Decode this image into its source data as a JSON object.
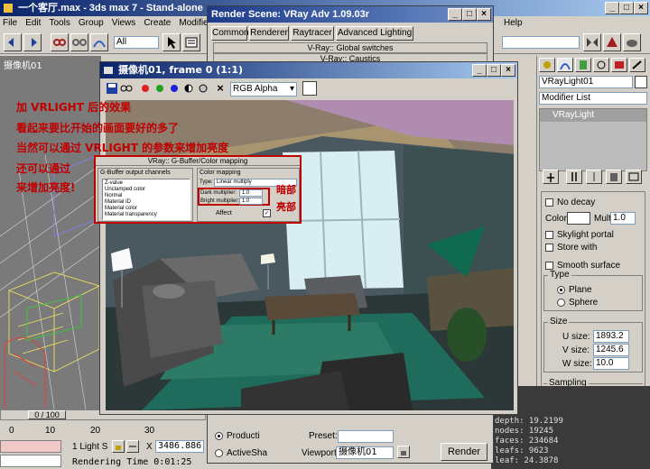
{
  "main_window": {
    "title": "一个客厅.max - 3ds max 7 - Stand-alone",
    "menu": [
      "File",
      "Edit",
      "Tools",
      "Group",
      "Views",
      "Create",
      "Modifiers",
      "Help"
    ],
    "selection_filter": "All",
    "viewport_label": "摄像机01"
  },
  "render_scene": {
    "title": "Render Scene: VRay Adv 1.09.03r",
    "tabs": [
      "Common",
      "Renderer",
      "Raytracer",
      "Advanced Lighting"
    ],
    "rollout_1": "V-Ray:: Global switches",
    "rollout_2": "V-Ray:: Caustics",
    "radio_production": "Producti",
    "radio_activeshade": "ActiveSha",
    "preset_label": "Preset:",
    "viewport_label": "Viewport:",
    "viewport_value": "摄像机01",
    "render_button": "Render"
  },
  "frame_window": {
    "title": "摄像机01, frame 0 (1:1)",
    "channel": "RGB Alpha"
  },
  "gbuffer_panel": {
    "title": "VRay:: G-Buffer/Color mapping",
    "channels_label": "G-Buffer output channels",
    "channels": [
      "Z-value",
      "Unclamped color",
      "Normal",
      "Material ID",
      "Material color",
      "Material transparency"
    ],
    "color_mapping_label": "Color mapping",
    "type_label": "Type:",
    "type_value": "Linear multiply",
    "dark_label": "Dark multiplier:",
    "dark_value": "1.0",
    "bright_label": "Bright multiplier:",
    "bright_value": "1.0",
    "affect_label": "Affect"
  },
  "annotations": {
    "line1": "加 VRLIGHT 后的效果",
    "line2": "看起来要比开始的画面要好的多了",
    "line3": "当然可以通过 VRLIGHT 的参数来增加亮度",
    "line4": "还可以通过",
    "line5": "来增加亮度!",
    "dark_note": "暗部",
    "bright_note": "亮部"
  },
  "command_panel": {
    "object_name": "VRayLight01",
    "modifier_list": "Modifier List",
    "stack_item": "VRayLight",
    "no_decay": "No decay",
    "color_label": "Color:",
    "mult_label": "Mult:",
    "mult_value": "1.0",
    "skylight": "Skylight portal",
    "store_with": "Store with",
    "smooth_surface": "Smooth surface",
    "type_group": "Type",
    "plane": "Plane",
    "sphere": "Sphere",
    "size_group": "Size",
    "u_label": "U size:",
    "u_value": "1893.2",
    "v_label": "V size:",
    "v_value": "1245.6",
    "w_label": "W size:",
    "w_value": "10.0",
    "sampling_group": "Sampling"
  },
  "stats": {
    "lines": [
      "depth: 19.2199",
      "nodes: 19245",
      "faces: 234684",
      "leafs: 9623",
      "leaf: 24.3878"
    ]
  },
  "timeline": {
    "position": "0 / 100",
    "ticks": [
      "0",
      "10",
      "20",
      "30"
    ]
  },
  "status": {
    "light_count": "1 Light S",
    "x_label": "X",
    "x_value": "3486.886",
    "render_time": "Rendering Time  0:01:25"
  }
}
